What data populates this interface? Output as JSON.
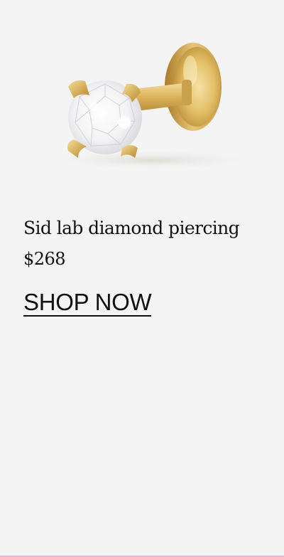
{
  "product": {
    "name": "Sid lab diamond piercing",
    "price": "$268"
  },
  "cta": {
    "label": "SHOP NOW"
  },
  "image": {
    "icon": "diamond-stud-piercing-image"
  },
  "colors": {
    "background": "#f4f4f4",
    "text": "#111111",
    "gold": "#d9b45a",
    "accent": "#e8b7cf"
  }
}
